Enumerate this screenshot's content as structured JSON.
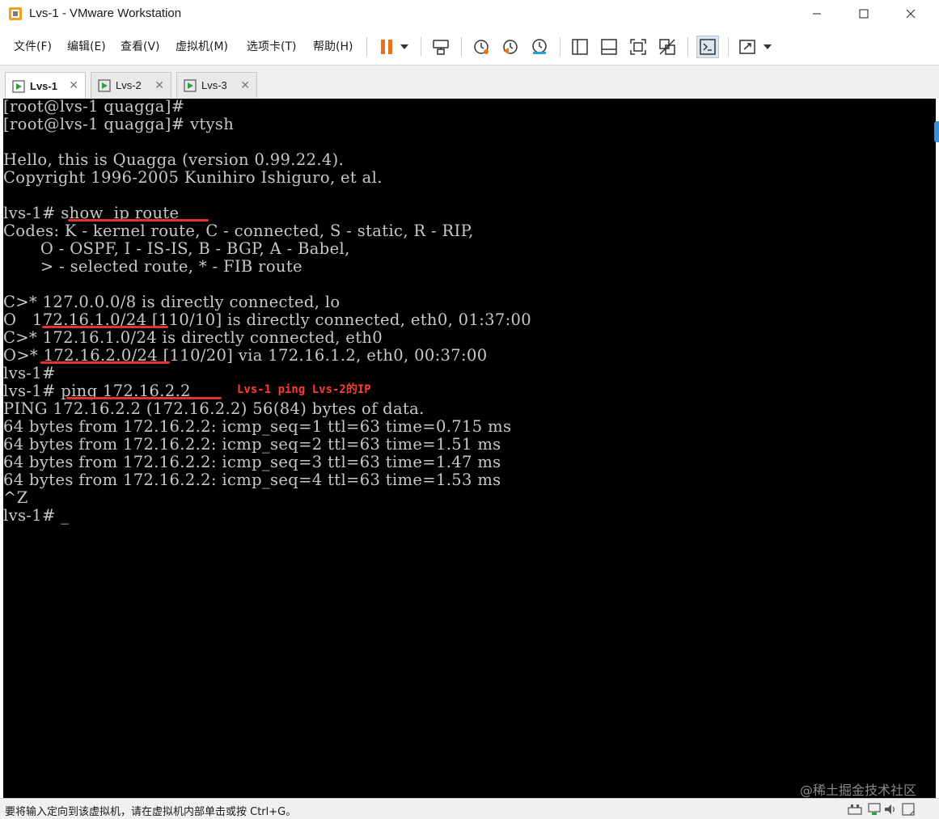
{
  "window": {
    "title": "Lvs-1 - VMware Workstation"
  },
  "menu": {
    "items": [
      "文件(F)",
      "编辑(E)",
      "查看(V)",
      "虚拟机(M)",
      "选项卡(T)",
      "帮助(H)"
    ]
  },
  "colors": {
    "accent_pause": "#e8731c",
    "console_bg": "#000000",
    "console_text": "#c8c8c8",
    "annotation": "#ff3b30",
    "vm_icon_green": "#2ea043"
  },
  "toolbar": {
    "icons": [
      "pause-icon",
      "dropdown-arrow-icon",
      "send-ctrl-alt-del-icon",
      "snapshot-icon",
      "revert-snapshot-icon",
      "snapshot-manager-icon",
      "show-library-icon",
      "thumbnail-bar-icon",
      "full-screen-icon",
      "unity-icon",
      "console-view-icon",
      "stretch-guest-icon",
      "dropdown-arrow-icon"
    ]
  },
  "tabs": [
    {
      "label": "Lvs-1",
      "active": true
    },
    {
      "label": "Lvs-2",
      "active": false
    },
    {
      "label": "Lvs-3",
      "active": false
    }
  ],
  "console": {
    "lines": [
      "[root@lvs-1 quagga]#",
      "[root@lvs-1 quagga]# vtysh",
      "",
      "Hello, this is Quagga (version 0.99.22.4).",
      "Copyright 1996-2005 Kunihiro Ishiguro, et al.",
      "",
      "lvs-1# show  ip route",
      "Codes: K - kernel route, C - connected, S - static, R - RIP,",
      "       O - OSPF, I - IS-IS, B - BGP, A - Babel,",
      "       > - selected route, * - FIB route",
      "",
      "C>* 127.0.0.0/8 is directly connected, lo",
      "O   172.16.1.0/24 [110/10] is directly connected, eth0, 01:37:00",
      "C>* 172.16.1.0/24 is directly connected, eth0",
      "O>* 172.16.2.0/24 [110/20] via 172.16.1.2, eth0, 00:37:00",
      "lvs-1#",
      "lvs-1# ping 172.16.2.2",
      "PING 172.16.2.2 (172.16.2.2) 56(84) bytes of data.",
      "64 bytes from 172.16.2.2: icmp_seq=1 ttl=63 time=0.715 ms",
      "64 bytes from 172.16.2.2: icmp_seq=2 ttl=63 time=1.51 ms",
      "64 bytes from 172.16.2.2: icmp_seq=3 ttl=63 time=1.47 ms",
      "64 bytes from 172.16.2.2: icmp_seq=4 ttl=63 time=1.53 ms",
      "^Z",
      "lvs-1# _"
    ],
    "annotation": "Lvs-1 ping Lvs-2的IP"
  },
  "watermark": "@稀土掘金技术社区",
  "status": {
    "text": "要将输入定向到该虚拟机，请在虚拟机内部单击或按 Ctrl+G。",
    "icons": [
      "network-adapter-icon",
      "device-icon",
      "sound-icon",
      "message-icon"
    ]
  }
}
